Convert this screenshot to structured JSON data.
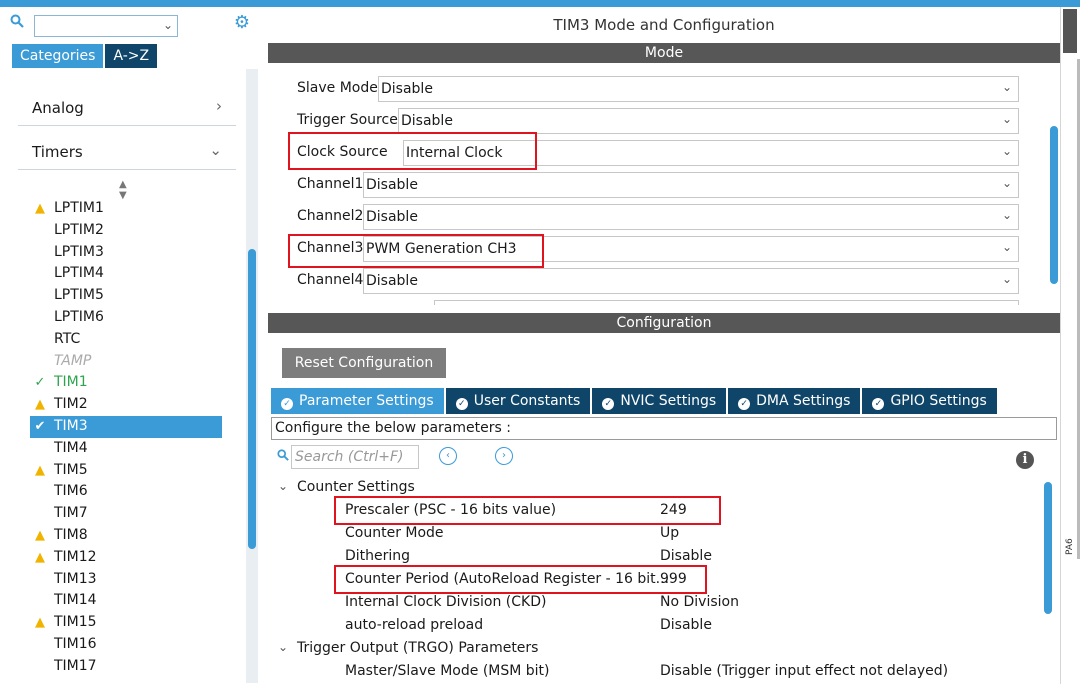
{
  "sidebar": {
    "tabs": [
      "Categories",
      "A->Z"
    ],
    "categories": [
      {
        "label": "Analog",
        "arrow": "›"
      },
      {
        "label": "Timers",
        "arrow": "⌄"
      }
    ],
    "timers": [
      {
        "label": "LPTIM1",
        "state": "warn"
      },
      {
        "label": "LPTIM2",
        "state": "none"
      },
      {
        "label": "LPTIM3",
        "state": "none"
      },
      {
        "label": "LPTIM4",
        "state": "none"
      },
      {
        "label": "LPTIM5",
        "state": "none"
      },
      {
        "label": "LPTIM6",
        "state": "none"
      },
      {
        "label": "RTC",
        "state": "none"
      },
      {
        "label": "TAMP",
        "state": "disabled"
      },
      {
        "label": "TIM1",
        "state": "ok"
      },
      {
        "label": "TIM2",
        "state": "warn"
      },
      {
        "label": "TIM3",
        "state": "selected"
      },
      {
        "label": "TIM4",
        "state": "none"
      },
      {
        "label": "TIM5",
        "state": "warn"
      },
      {
        "label": "TIM6",
        "state": "none"
      },
      {
        "label": "TIM7",
        "state": "none"
      },
      {
        "label": "TIM8",
        "state": "warn"
      },
      {
        "label": "TIM12",
        "state": "warn"
      },
      {
        "label": "TIM13",
        "state": "none"
      },
      {
        "label": "TIM14",
        "state": "none"
      },
      {
        "label": "TIM15",
        "state": "warn"
      },
      {
        "label": "TIM16",
        "state": "none"
      },
      {
        "label": "TIM17",
        "state": "none"
      }
    ]
  },
  "panel": {
    "title": "TIM3 Mode and Configuration",
    "mode_header": "Mode",
    "config_header": "Configuration"
  },
  "mode": {
    "slave_mode": {
      "label": "Slave Mode",
      "value": "Disable"
    },
    "trigger_source": {
      "label": "Trigger Source",
      "value": "Disable"
    },
    "clock_source": {
      "label": "Clock Source",
      "value": "Internal Clock"
    },
    "channel1": {
      "label": "Channel1",
      "value": "Disable"
    },
    "channel2": {
      "label": "Channel2",
      "value": "Disable"
    },
    "channel3": {
      "label": "Channel3",
      "value": "PWM Generation CH3"
    },
    "channel4": {
      "label": "Channel4",
      "value": "Disable"
    }
  },
  "config": {
    "reset_label": "Reset Configuration",
    "tabs": [
      "Parameter Settings",
      "User Constants",
      "NVIC Settings",
      "DMA Settings",
      "GPIO Settings"
    ],
    "configure_text": "Configure the below parameters :",
    "search_placeholder": "Search (Ctrl+F)",
    "counter_group": "Counter Settings",
    "trgo_group": "Trigger Output (TRGO) Parameters",
    "params": [
      {
        "name": "Prescaler (PSC - 16 bits value)",
        "value": "249"
      },
      {
        "name": "Counter Mode",
        "value": "Up"
      },
      {
        "name": "Dithering",
        "value": "Disable"
      },
      {
        "name": "Counter Period (AutoReload Register - 16 bit...",
        "value": "999"
      },
      {
        "name": "Internal Clock Division (CKD)",
        "value": "No Division"
      },
      {
        "name": "auto-reload preload",
        "value": "Disable"
      }
    ],
    "trgo_params": [
      {
        "name": "Master/Slave Mode (MSM bit)",
        "value": "Disable (Trigger input effect not delayed)"
      }
    ]
  },
  "edge": {
    "pin_label": "PA6"
  },
  "colors": {
    "accent": "#3a9bd6",
    "dark_tab": "#0f4569",
    "highlight_box": "#e0141e",
    "warning": "#f0b400",
    "ok": "#2ea44f"
  }
}
